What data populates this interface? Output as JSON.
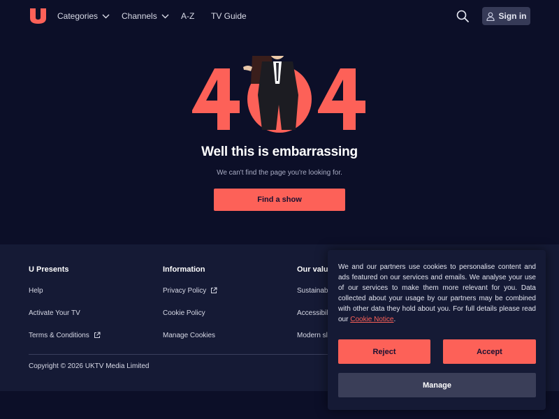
{
  "header": {
    "logo_icon": "u-logo-icon",
    "nav": [
      {
        "label": "Categories",
        "has_dropdown": true
      },
      {
        "label": "Channels",
        "has_dropdown": true
      },
      {
        "label": "A-Z",
        "has_dropdown": false
      },
      {
        "label": "TV Guide",
        "has_dropdown": false
      }
    ],
    "search_icon": "search-icon",
    "signin_label": "Sign in"
  },
  "hero": {
    "code_text": "404",
    "title": "Well this is embarrassing",
    "subtitle": "We can't find the page you're looking for.",
    "cta_label": "Find a show"
  },
  "footer": {
    "columns": [
      {
        "heading": "U Presents",
        "links": [
          {
            "label": "Help",
            "external": false
          },
          {
            "label": "Activate Your TV",
            "external": false
          },
          {
            "label": "Terms & Conditions",
            "external": true
          }
        ]
      },
      {
        "heading": "Information",
        "links": [
          {
            "label": "Privacy Policy",
            "external": true
          },
          {
            "label": "Cookie Policy",
            "external": false
          },
          {
            "label": "Manage Cookies",
            "external": false
          }
        ]
      },
      {
        "heading": "Our value",
        "links": [
          {
            "label": "Sustainabi",
            "external": false
          },
          {
            "label": "Accessibil",
            "external": false
          },
          {
            "label": "Modern sl",
            "external": false
          }
        ]
      }
    ],
    "copyright": "Copyright © 2026 UKTV Media Limited"
  },
  "cookie_banner": {
    "text": "We and our partners use cookies to personalise content and ads featured on our services and emails. We analyse your use of our services to make them more relevant for you. Data collected about your usage by our partners may be combined with other data they hold about you. For full details please read our ",
    "link_text": "Cookie Notice",
    "text_end": ".",
    "reject_label": "Reject",
    "accept_label": "Accept",
    "manage_label": "Manage"
  },
  "colors": {
    "background": "#0c0f28",
    "footer_bg": "#151a35",
    "accent": "#fd6158",
    "signin_bg": "#363a57"
  }
}
